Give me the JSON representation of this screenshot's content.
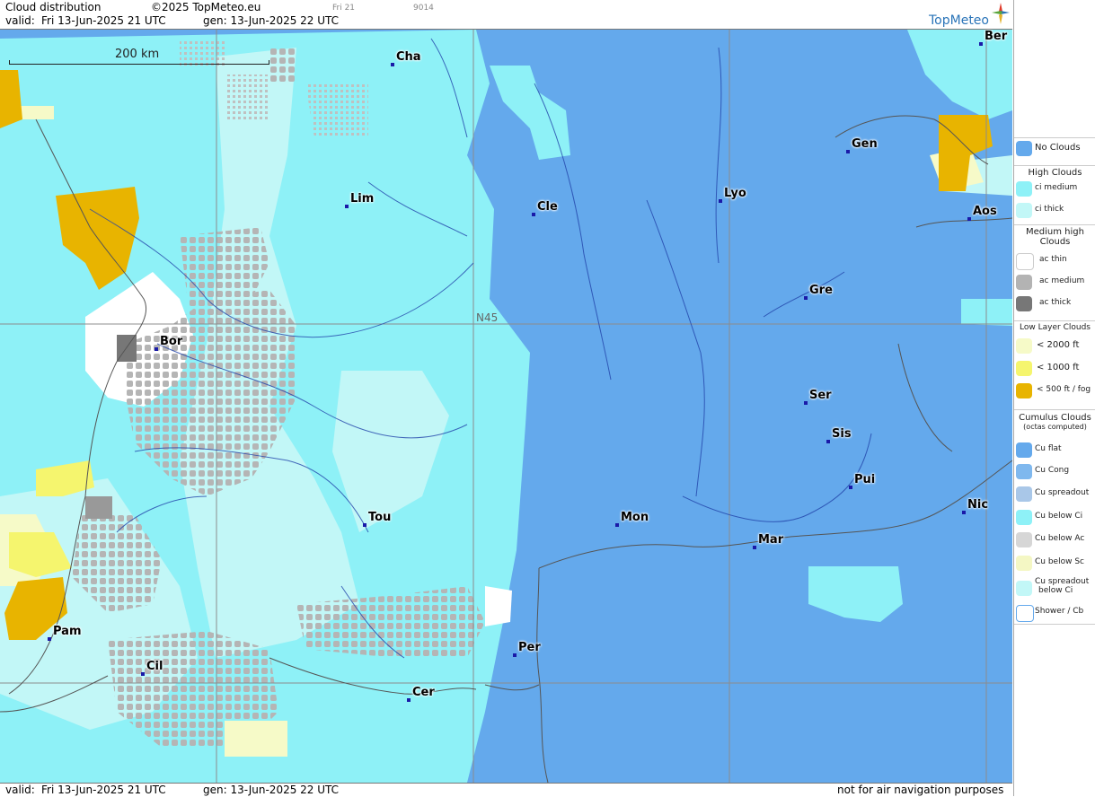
{
  "header": {
    "title": "Cloud distribution",
    "copyright": "©2025 TopMeteo.eu",
    "day_code": "Fri 21",
    "code": "9014",
    "valid_label": "valid:",
    "valid_value": "Fri  13-Jun-2025  21 UTC",
    "gen_value": "gen: 13-Jun-2025 22 UTC",
    "logo": "TopMeteo"
  },
  "footer": {
    "valid_label": "valid:",
    "valid_value": "Fri  13-Jun-2025  21 UTC",
    "gen_value": "gen: 13-Jun-2025 22 UTC",
    "disclaimer": "not for air navigation purposes"
  },
  "map": {
    "scale_label": "200 km",
    "grid_label": "N45",
    "cities": [
      {
        "name": "Cha"
      },
      {
        "name": "Lim"
      },
      {
        "name": "Cle"
      },
      {
        "name": "Lyo"
      },
      {
        "name": "Gen"
      },
      {
        "name": "Ber"
      },
      {
        "name": "Aos"
      },
      {
        "name": "Gre"
      },
      {
        "name": "Bor"
      },
      {
        "name": "Ser"
      },
      {
        "name": "Sis"
      },
      {
        "name": "Pui"
      },
      {
        "name": "Tou"
      },
      {
        "name": "Mon"
      },
      {
        "name": "Mar"
      },
      {
        "name": "Nic"
      },
      {
        "name": "Pam"
      },
      {
        "name": "Per"
      },
      {
        "name": "Cil"
      },
      {
        "name": "Cer"
      }
    ]
  },
  "legend": {
    "no_clouds": "No Clouds",
    "high_title": "High Clouds",
    "ci_medium": "ci medium",
    "ci_thick": "ci thick",
    "medium_title_1": "Medium high",
    "medium_title_2": "Clouds",
    "ac_thin": "ac thin",
    "ac_medium": "ac medium",
    "ac_thick": "ac thick",
    "low_title": "Low Layer Clouds",
    "low_2000": "< 2000 ft",
    "low_1000": "< 1000 ft",
    "low_500": "< 500 ft / fog",
    "cu_title": "Cumulus Clouds",
    "cu_subtitle": "(octas computed)",
    "cu_flat": "Cu flat",
    "cu_cong": "Cu Cong",
    "cu_spread": "Cu spreadout",
    "cu_below_ci": "Cu below Ci",
    "cu_below_ac": "Cu below Ac",
    "cu_below_sc": "Cu below Sc",
    "cu_spread_ci_1": "Cu spreadout",
    "cu_spread_ci_2": "below Ci",
    "shower": "Shower / Cb"
  },
  "colors": {
    "no_clouds": "#64a9ec",
    "ci_medium": "#8ef1f7",
    "ci_thick": "#c2f7f7",
    "ac_thin": "#ffffff",
    "ac_medium": "#b3b3b3",
    "ac_thick": "#777777",
    "low_2000": "#f6fac8",
    "low_1000": "#f5f56e",
    "low_500": "#e8b400"
  }
}
